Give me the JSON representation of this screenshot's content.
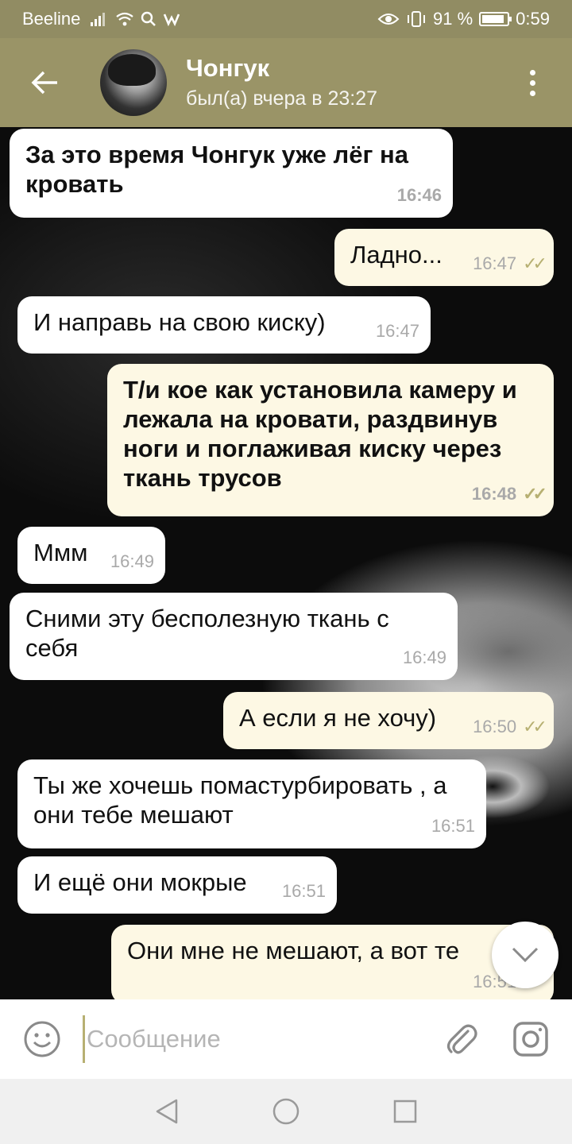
{
  "status_bar": {
    "carrier": "Beeline",
    "battery_percent": "91 %",
    "battery_level": 0.91,
    "time": "0:59"
  },
  "header": {
    "contact_name": "Чонгук",
    "last_seen": "был(а) вчера в 23:27"
  },
  "messages": [
    {
      "text": "За это время Чонгук уже лёг на кровать",
      "time": "16:46",
      "direction": "in",
      "bold": true
    },
    {
      "text": "Ладно...",
      "time": "16:47",
      "direction": "out"
    },
    {
      "text": "И направь на свою киску)",
      "time": "16:47",
      "direction": "in"
    },
    {
      "text": "Т/и кое как установила камеру и лежала на кровати, раздвинув ноги и поглаживая киску через ткань трусов",
      "time": "16:48",
      "direction": "out",
      "bold": true
    },
    {
      "text": "Ммм",
      "time": "16:49",
      "direction": "in"
    },
    {
      "text": "Сними эту бесполезную ткань с себя",
      "time": "16:49",
      "direction": "in"
    },
    {
      "text": "А если я не хочу)",
      "time": "16:50",
      "direction": "out"
    },
    {
      "text": "Ты же хочешь помастурбировать , а они тебе мешают",
      "time": "16:51",
      "direction": "in"
    },
    {
      "text": "И ещё они мокрые",
      "time": "16:51",
      "direction": "in"
    },
    {
      "text": "Они мне не мешают, а вот те",
      "time": "16:51",
      "direction": "out"
    }
  ],
  "input": {
    "placeholder": "Сообщение"
  },
  "icons": {
    "back": "arrow-left-icon",
    "menu": "more-vert-icon",
    "scroll_down": "chevron-down-icon",
    "emoji": "smiley-icon",
    "attach": "paperclip-icon",
    "camera": "camera-icon"
  },
  "colors": {
    "header": "#9a9467",
    "outgoing_bubble": "#fdf8e4",
    "incoming_bubble": "#ffffff",
    "read_ticks": "#b7b072"
  }
}
